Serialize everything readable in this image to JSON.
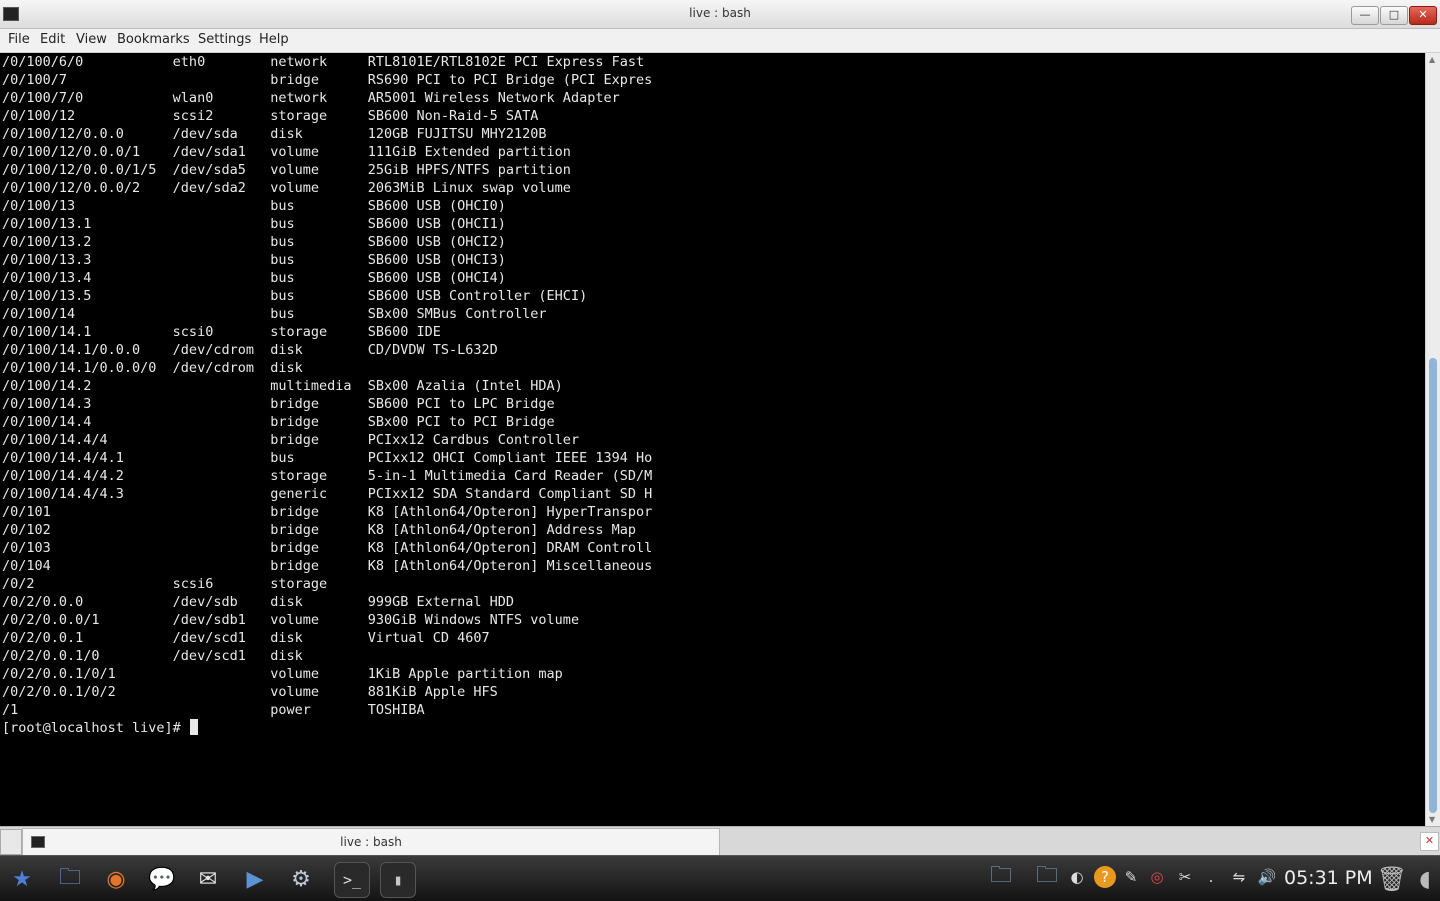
{
  "window": {
    "title": "live : bash"
  },
  "menu": [
    "File",
    "Edit",
    "View",
    "Bookmarks",
    "Settings",
    "Help"
  ],
  "terminal": {
    "lines": [
      "/0/100/6/0           eth0        network     RTL8101E/RTL8102E PCI Express Fast",
      "/0/100/7                         bridge      RS690 PCI to PCI Bridge (PCI Expres",
      "/0/100/7/0           wlan0       network     AR5001 Wireless Network Adapter",
      "/0/100/12            scsi2       storage     SB600 Non-Raid-5 SATA",
      "/0/100/12/0.0.0      /dev/sda    disk        120GB FUJITSU MHY2120B",
      "/0/100/12/0.0.0/1    /dev/sda1   volume      111GiB Extended partition",
      "/0/100/12/0.0.0/1/5  /dev/sda5   volume      25GiB HPFS/NTFS partition",
      "/0/100/12/0.0.0/2    /dev/sda2   volume      2063MiB Linux swap volume",
      "/0/100/13                        bus         SB600 USB (OHCI0)",
      "/0/100/13.1                      bus         SB600 USB (OHCI1)",
      "/0/100/13.2                      bus         SB600 USB (OHCI2)",
      "/0/100/13.3                      bus         SB600 USB (OHCI3)",
      "/0/100/13.4                      bus         SB600 USB (OHCI4)",
      "/0/100/13.5                      bus         SB600 USB Controller (EHCI)",
      "/0/100/14                        bus         SBx00 SMBus Controller",
      "/0/100/14.1          scsi0       storage     SB600 IDE",
      "/0/100/14.1/0.0.0    /dev/cdrom  disk        CD/DVDW TS-L632D",
      "/0/100/14.1/0.0.0/0  /dev/cdrom  disk",
      "/0/100/14.2                      multimedia  SBx00 Azalia (Intel HDA)",
      "/0/100/14.3                      bridge      SB600 PCI to LPC Bridge",
      "/0/100/14.4                      bridge      SBx00 PCI to PCI Bridge",
      "/0/100/14.4/4                    bridge      PCIxx12 Cardbus Controller",
      "/0/100/14.4/4.1                  bus         PCIxx12 OHCI Compliant IEEE 1394 Ho",
      "/0/100/14.4/4.2                  storage     5-in-1 Multimedia Card Reader (SD/M",
      "/0/100/14.4/4.3                  generic     PCIxx12 SDA Standard Compliant SD H",
      "/0/101                           bridge      K8 [Athlon64/Opteron] HyperTranspor",
      "/0/102                           bridge      K8 [Athlon64/Opteron] Address Map",
      "/0/103                           bridge      K8 [Athlon64/Opteron] DRAM Controll",
      "/0/104                           bridge      K8 [Athlon64/Opteron] Miscellaneous",
      "/0/2                 scsi6       storage",
      "/0/2/0.0.0           /dev/sdb    disk        999GB External HDD",
      "/0/2/0.0.0/1         /dev/sdb1   volume      930GiB Windows NTFS volume",
      "/0/2/0.0.1           /dev/scd1   disk        Virtual CD 4607",
      "/0/2/0.0.1/0         /dev/scd1   disk",
      "/0/2/0.0.1/0/1                   volume      1KiB Apple partition map",
      "/0/2/0.0.1/0/2                   volume      881KiB Apple HFS",
      "/1                               power       TOSHIBA"
    ],
    "prompt": "[root@localhost live]# "
  },
  "tab": {
    "label": "live : bash"
  },
  "taskbar": {
    "apps": [
      {
        "name": "kde-menu-icon",
        "glyph": "★",
        "color": "#4d7fd6"
      },
      {
        "name": "file-manager-icon",
        "glyph": "🗀",
        "color": "#6aa2d8"
      },
      {
        "name": "firefox-icon",
        "glyph": "◉",
        "color": "#e2762b"
      },
      {
        "name": "chat-icon",
        "glyph": "💬",
        "color": "#f2c21d"
      },
      {
        "name": "mail-icon",
        "glyph": "✉",
        "color": "#e9e9e9"
      },
      {
        "name": "media-player-icon",
        "glyph": "▶",
        "color": "#5b93d6"
      },
      {
        "name": "system-settings-icon",
        "glyph": "⚙",
        "color": "#bfc9d6"
      },
      {
        "name": "terminal-task-icon",
        "glyph": ">_",
        "color": "#dddddd"
      },
      {
        "name": "usb-device-task-icon",
        "glyph": "▮",
        "color": "#c8c8c8"
      }
    ],
    "tray": [
      {
        "name": "folder-tray-icon",
        "glyph": "🗀"
      },
      {
        "name": "folder2-tray-icon",
        "glyph": "🗀"
      },
      {
        "name": "update-tray-icon",
        "glyph": "◐"
      },
      {
        "name": "help-tray-icon",
        "glyph": "?"
      },
      {
        "name": "notes-tray-icon",
        "glyph": "✎"
      },
      {
        "name": "lifebuoy-tray-icon",
        "glyph": "◎"
      },
      {
        "name": "scissors-tray-icon",
        "glyph": "✂"
      },
      {
        "name": "dot-tray-icon",
        "glyph": "."
      },
      {
        "name": "network-tray-icon",
        "glyph": "⇋"
      },
      {
        "name": "volume-tray-icon",
        "glyph": "🔊"
      }
    ],
    "clock": "05:31 PM"
  }
}
